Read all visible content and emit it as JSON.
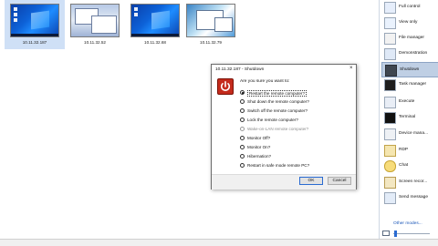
{
  "thumbnails": [
    {
      "caption": "10.11.32.187",
      "selected": true
    },
    {
      "caption": "10.11.32.52",
      "selected": false
    },
    {
      "caption": "10.11.32.68",
      "selected": false
    },
    {
      "caption": "10.11.32.79",
      "selected": false
    }
  ],
  "panel": {
    "items": [
      {
        "label": "Full control",
        "icon": "full-control-icon"
      },
      {
        "label": "View only",
        "icon": "view-only-icon"
      },
      {
        "label": "File manager",
        "icon": "file-manager-icon"
      },
      {
        "label": "Demonstration",
        "icon": "demonstration-icon"
      },
      {
        "label": "Shutdown",
        "icon": "shutdown-icon",
        "active": true
      },
      {
        "label": "Task manager",
        "icon": "task-manager-icon"
      },
      {
        "label": "Execute",
        "icon": "execute-icon"
      },
      {
        "label": "Terminal",
        "icon": "terminal-icon"
      },
      {
        "label": "Device mana...",
        "icon": "device-manager-icon"
      },
      {
        "label": "RDP",
        "icon": "rdp-icon"
      },
      {
        "label": "Chat",
        "icon": "chat-icon"
      },
      {
        "label": "Screen recor...",
        "icon": "screen-recorder-icon"
      },
      {
        "label": "Send message",
        "icon": "send-message-icon"
      }
    ],
    "more_label": "Other modes..."
  },
  "dialog": {
    "title": "10.11.32.187 - Shutdown",
    "close_glyph": "×",
    "prompt": "Are you sure you want to:",
    "options": [
      {
        "label": "Restart the remote computer?",
        "checked": true,
        "enabled": true
      },
      {
        "label": "Shut down the remote computer?",
        "checked": false,
        "enabled": true
      },
      {
        "label": "Switch off the remote computer?",
        "checked": false,
        "enabled": true
      },
      {
        "label": "Lock the remote computer?",
        "checked": false,
        "enabled": true
      },
      {
        "label": "Wake-on-LAN remote computer?",
        "checked": false,
        "enabled": false
      },
      {
        "label": "Monitor Off?",
        "checked": false,
        "enabled": true
      },
      {
        "label": "Monitor On?",
        "checked": false,
        "enabled": true
      },
      {
        "label": "Hibernation?",
        "checked": false,
        "enabled": true
      },
      {
        "label": "Restart in safe mode remote PC?",
        "checked": false,
        "enabled": true
      }
    ],
    "ok_label": "OK",
    "cancel_label": "Cancel"
  },
  "colors": {
    "selection": "#cfe0f6",
    "shutdown_red": "#c42b1c",
    "link": "#1a56b8"
  }
}
